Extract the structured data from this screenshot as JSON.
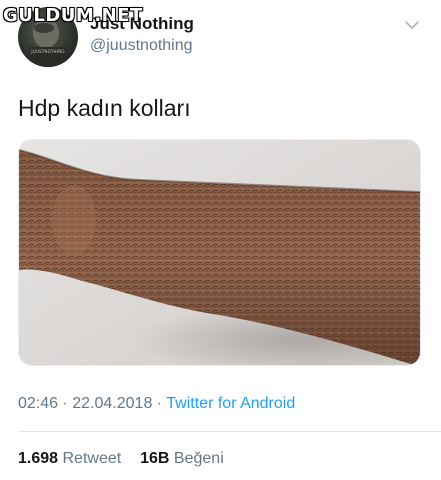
{
  "watermark": {
    "text": "GULDUM.NET"
  },
  "author": {
    "display_name": "Just Nothing",
    "handle": "@juustnothing",
    "avatar_caption": "JUUSTNOTHING"
  },
  "icons": {
    "menu": "chevron-down-icon"
  },
  "tweet": {
    "text": "Hdp kadın kolları",
    "time": "02:46",
    "separator1": " · ",
    "date": "22.04.2018",
    "separator2": " · ",
    "source": "Twitter for Android"
  },
  "stats": {
    "retweet_count": "1.698",
    "retweet_label": "Retweet",
    "like_count": "16B",
    "like_label": "Beğeni"
  },
  "colors": {
    "text": "#14171a",
    "secondary": "#657786",
    "link": "#1da1f2",
    "divider": "#e1e8ed"
  }
}
